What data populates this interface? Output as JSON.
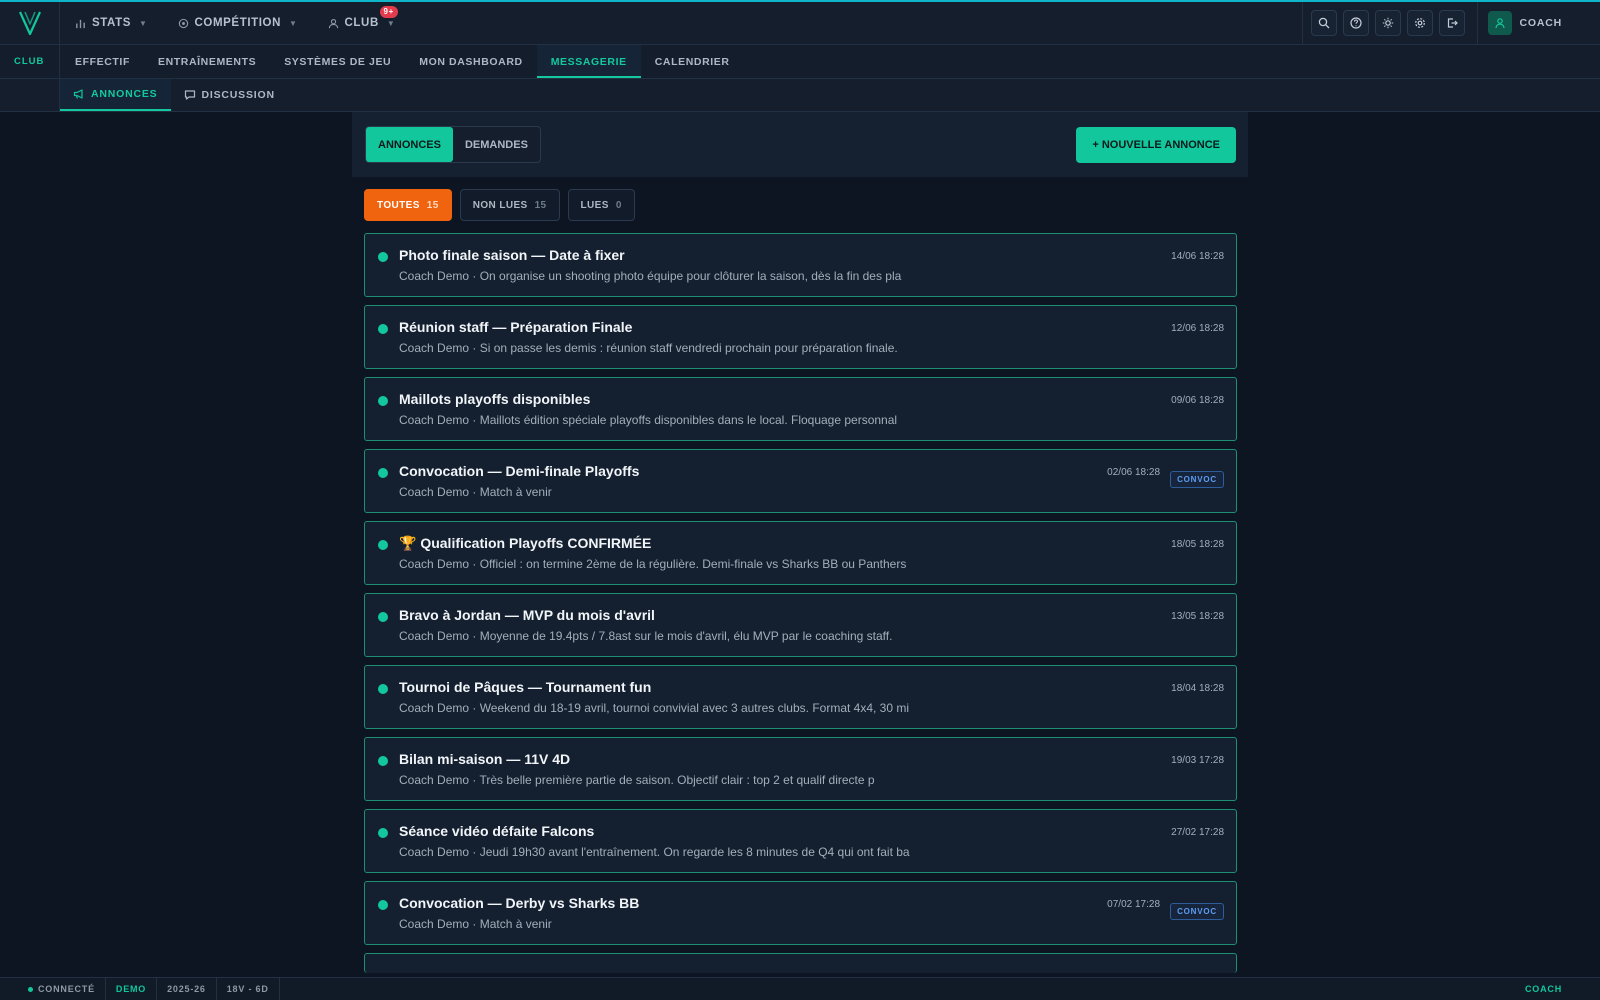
{
  "colors": {
    "accent": "#13c79d",
    "filter_active": "#f0640f",
    "badge": "#e23b4e",
    "tag": "#5c9df0"
  },
  "topbar": {
    "nav": [
      {
        "label": "STATS",
        "icon": "bar-chart-icon"
      },
      {
        "label": "COMPÉTITION",
        "icon": "target-icon"
      },
      {
        "label": "CLUB",
        "icon": "users-icon",
        "badge": "9+"
      }
    ],
    "actions": [
      "search-icon",
      "help-icon",
      "sun-icon",
      "gear-icon",
      "logout-icon"
    ],
    "user_label": "COACH"
  },
  "section": {
    "label": "CLUB",
    "tabs": [
      "EFFECTIF",
      "ENTRAÎNEMENTS",
      "SYSTÈMES DE JEU",
      "MON DASHBOARD",
      "MESSAGERIE",
      "CALENDRIER"
    ],
    "active_tab": "MESSAGERIE"
  },
  "subnav": {
    "tabs": [
      "ANNONCES",
      "DISCUSSION"
    ]
  },
  "toolbar": {
    "segments": [
      "ANNONCES",
      "DEMANDES"
    ],
    "new_button": "+ NOUVELLE ANNONCE"
  },
  "filters": [
    {
      "label": "TOUTES",
      "count": "15"
    },
    {
      "label": "NON LUES",
      "count": "15"
    },
    {
      "label": "LUES",
      "count": "0"
    }
  ],
  "messages": [
    {
      "title": "Photo finale saison — Date à fixer",
      "preview": "Coach Demo · On organise un shooting photo équipe pour clôturer la saison, dès la fin des pla",
      "date": "14/06 18:28",
      "tag": ""
    },
    {
      "title": "Réunion staff — Préparation Finale",
      "preview": "Coach Demo · Si on passe les demis : réunion staff vendredi prochain pour préparation finale.",
      "date": "12/06 18:28",
      "tag": ""
    },
    {
      "title": "Maillots playoffs disponibles",
      "preview": "Coach Demo · Maillots édition spéciale playoffs disponibles dans le local. Floquage personnal",
      "date": "09/06 18:28",
      "tag": ""
    },
    {
      "title": "Convocation — Demi-finale Playoffs",
      "preview": "Coach Demo · Match à venir",
      "date": "02/06 18:28",
      "tag": "CONVOC"
    },
    {
      "title": "🏆 Qualification Playoffs CONFIRMÉE",
      "preview": "Coach Demo · Officiel : on termine 2ème de la régulière. Demi-finale vs Sharks BB ou Panthers",
      "date": "18/05 18:28",
      "tag": ""
    },
    {
      "title": "Bravo à Jordan — MVP du mois d'avril",
      "preview": "Coach Demo · Moyenne de 19.4pts / 7.8ast sur le mois d'avril, élu MVP par le coaching staff.",
      "date": "13/05 18:28",
      "tag": ""
    },
    {
      "title": "Tournoi de Pâques — Tournament fun",
      "preview": "Coach Demo · Weekend du 18-19 avril, tournoi convivial avec 3 autres clubs. Format 4x4, 30 mi",
      "date": "18/04 18:28",
      "tag": ""
    },
    {
      "title": "Bilan mi-saison — 11V 4D",
      "preview": "Coach Demo · Très belle première partie de saison. Objectif clair : top 2 et qualif directe p",
      "date": "19/03 17:28",
      "tag": ""
    },
    {
      "title": "Séance vidéo défaite Falcons",
      "preview": "Coach Demo · Jeudi 19h30 avant l'entraînement. On regarde les 8 minutes de Q4 qui ont fait ba",
      "date": "27/02 17:28",
      "tag": ""
    },
    {
      "title": "Convocation — Derby vs Sharks BB",
      "preview": "Coach Demo · Match à venir",
      "date": "07/02 17:28",
      "tag": "CONVOC"
    }
  ],
  "statusbar": {
    "connection": "CONNECTÉ",
    "mode": "DEMO",
    "season": "2025-26",
    "record": "18V - 6D",
    "role": "COACH"
  }
}
